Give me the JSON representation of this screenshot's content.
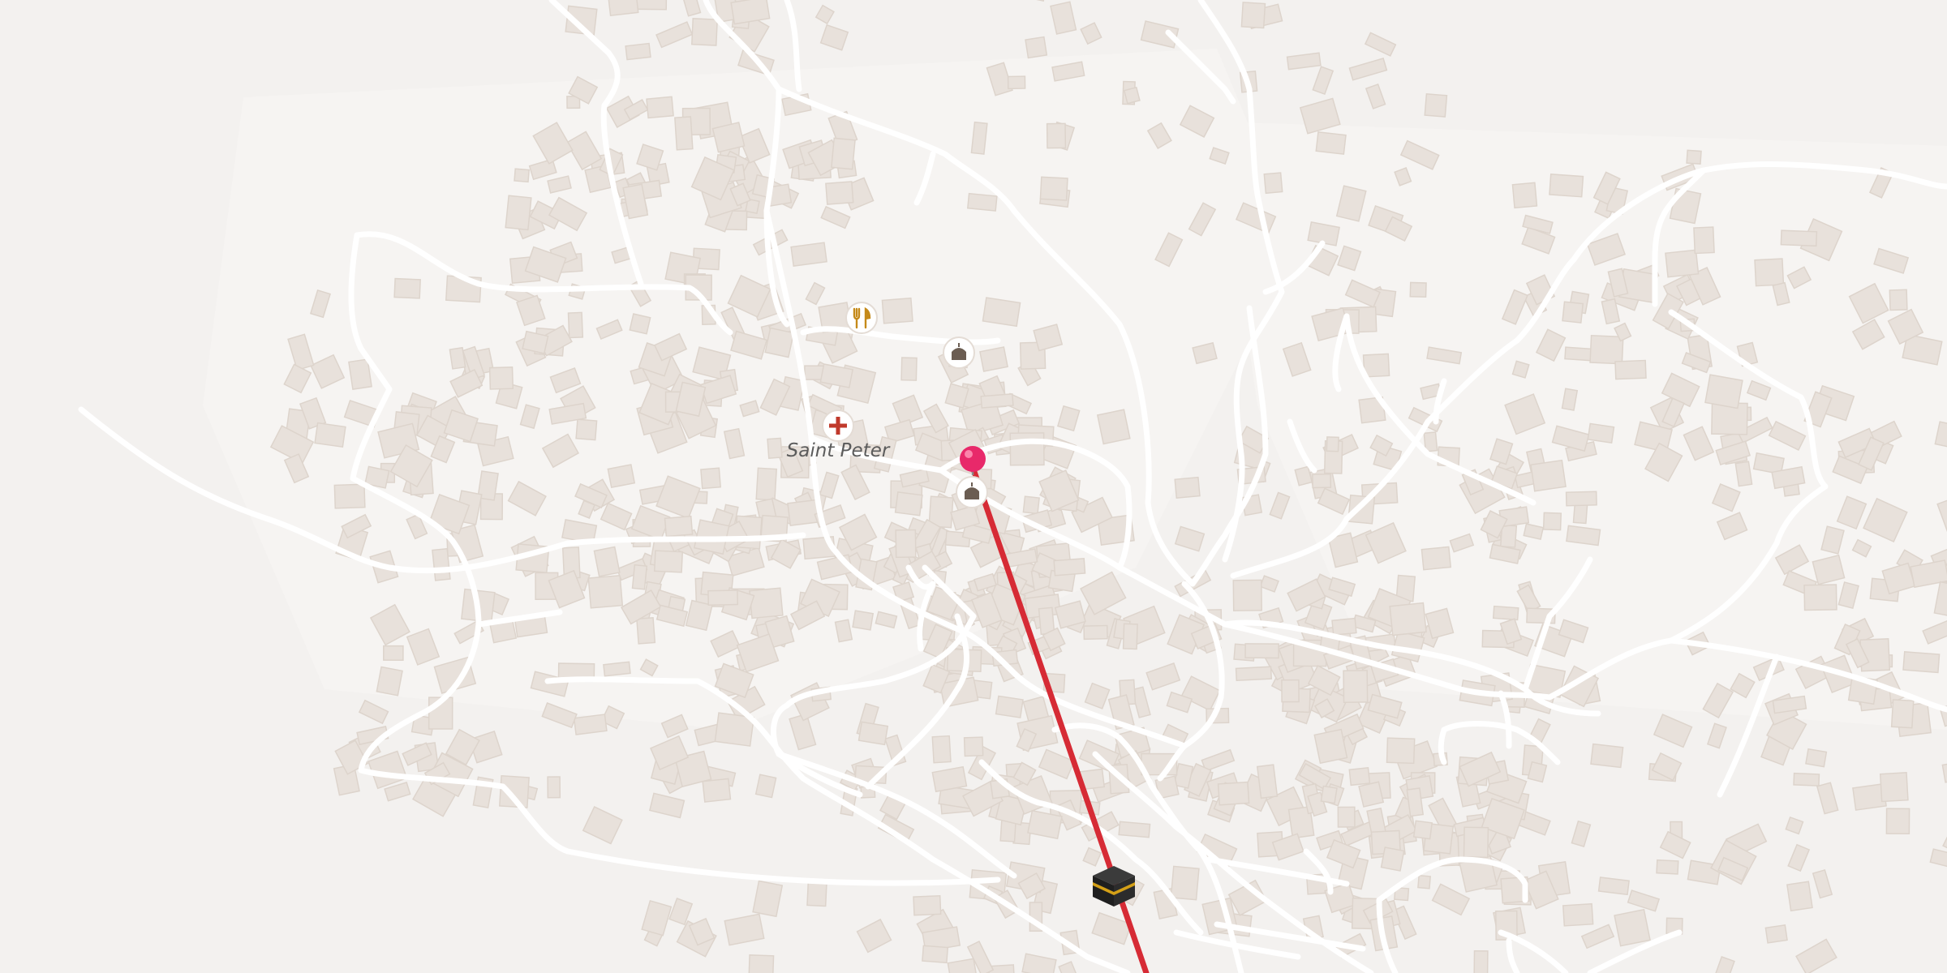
{
  "map": {
    "background_color": "#f3f1ef",
    "road_color": "#ffffff",
    "building_color": "#e8e1db",
    "route_color": "#d62b35",
    "pin_color": "#e8296a",
    "places": [
      {
        "id": "saint-peter",
        "label": "Saint Peter",
        "icon": "hospital-icon"
      }
    ],
    "poi_icons": [
      "restaurant-icon",
      "mosque-icon",
      "hospital-icon",
      "mosque-icon",
      "kaaba-icon",
      "location-pin-icon"
    ]
  }
}
